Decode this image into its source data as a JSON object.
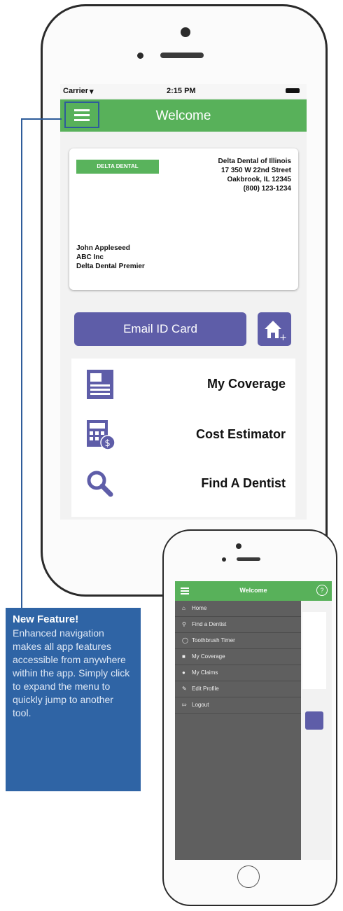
{
  "big_phone": {
    "status_bar": {
      "carrier": "Carrier",
      "time": "2:15 PM"
    },
    "header": {
      "title": "Welcome"
    },
    "id_card": {
      "logo_text": "DELTA DENTAL",
      "address_lines": [
        "Delta Dental of Illinois",
        "17 350 W 22nd Street",
        "Oakbrook, IL 12345",
        "(800) 123-1234"
      ],
      "member_lines": [
        "John Appleseed",
        "ABC Inc",
        "Delta Dental Premier"
      ]
    },
    "email_button": "Email ID Card",
    "menu": [
      {
        "label": "My Coverage",
        "icon": "document-icon"
      },
      {
        "label": "Cost Estimator",
        "icon": "calculator-icon"
      },
      {
        "label": "Find A Dentist",
        "icon": "magnifier-icon"
      }
    ]
  },
  "callout": {
    "heading": "New Feature!",
    "body": "Enhanced navigation makes all app features accessible from anywhere within the app. Simply click to expand the menu to quickly jump to another tool."
  },
  "small_phone": {
    "header": {
      "title": "Welcome",
      "help": "?"
    },
    "drawer_items": [
      {
        "label": "Home",
        "icon": "home-icon"
      },
      {
        "label": "Find a Dentist",
        "icon": "search-icon"
      },
      {
        "label": "Toothbrush Timer",
        "icon": "timer-icon"
      },
      {
        "label": "My Coverage",
        "icon": "coverage-icon"
      },
      {
        "label": "My Claims",
        "icon": "claims-icon"
      },
      {
        "label": "Edit Profile",
        "icon": "edit-icon"
      },
      {
        "label": "Logout",
        "icon": "logout-icon"
      }
    ]
  },
  "colors": {
    "accent_green": "#58b15a",
    "button_purple": "#5e5da8",
    "callout_blue": "#2f64a5",
    "drawer_gray": "#5f5f5f"
  }
}
